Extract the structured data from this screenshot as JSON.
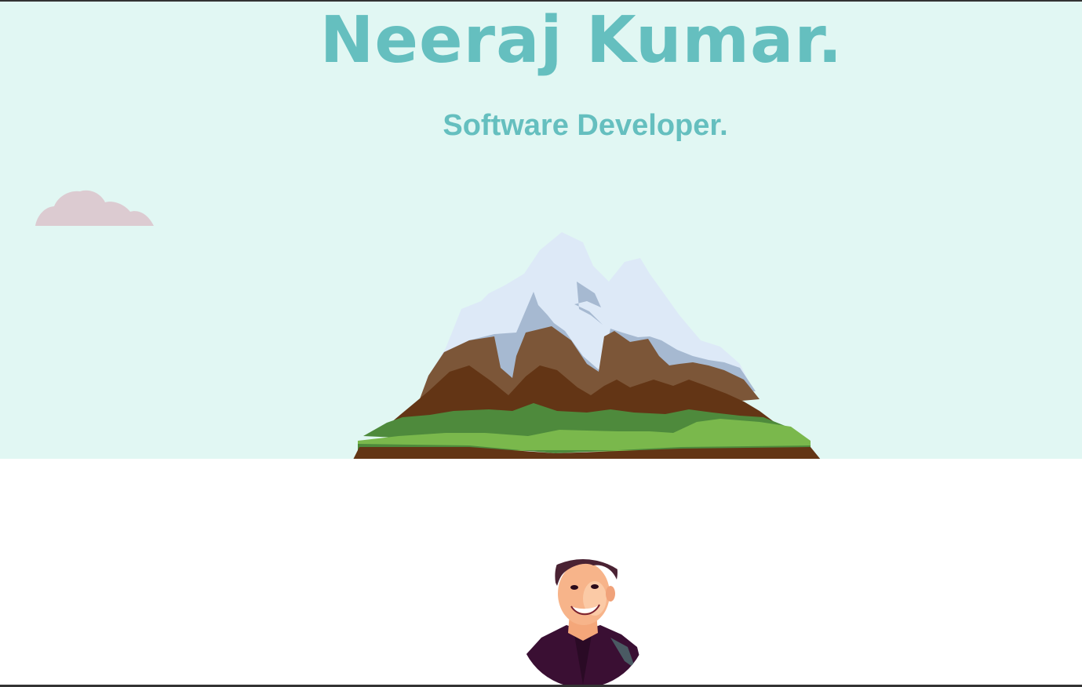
{
  "hero": {
    "name": "Neeraj Kumar.",
    "subtitle": "Software Developer."
  },
  "icons": {
    "cloud": "cloud-icon",
    "mountain": "mountain-illustration",
    "avatar": "profile-photo"
  },
  "colors": {
    "hero_background": "#e1f7f3",
    "accent_text": "#65bfbf",
    "cloud": "#dccbd1",
    "snow": "#dde9f7",
    "rock_shadow": "#a6b9d1",
    "rock_light": "#7c5638",
    "rock_dark": "#633515",
    "grass_dark": "#4e8a3c",
    "grass_light": "#7ab84c"
  }
}
